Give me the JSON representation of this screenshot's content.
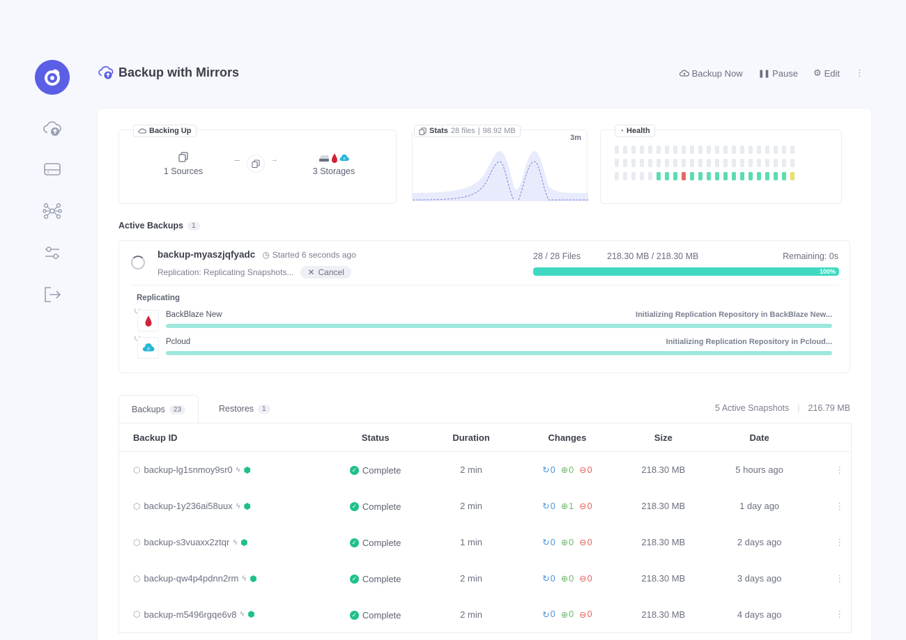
{
  "sidebar": {
    "items": [
      {
        "name": "backups",
        "icon": "cloud-upload-icon"
      },
      {
        "name": "storages",
        "icon": "hard-drive-icon"
      },
      {
        "name": "connections",
        "icon": "network-icon"
      },
      {
        "name": "settings",
        "icon": "sliders-icon"
      },
      {
        "name": "logout",
        "icon": "logout-icon"
      }
    ]
  },
  "header": {
    "title": "Backup with Mirrors",
    "actions": {
      "backup_now": "Backup Now",
      "pause": "Pause",
      "edit": "Edit"
    }
  },
  "summary": {
    "backing_up": {
      "label": "Backing Up",
      "sources": "1 Sources",
      "storages": "3 Storages"
    },
    "stats": {
      "label": "Stats",
      "files": "28 files",
      "size": "98.92 MB",
      "time": "3m"
    },
    "health": {
      "label": "Health"
    }
  },
  "active_backups": {
    "title": "Active Backups",
    "count": "1",
    "item": {
      "id": "backup-myaszjqfyadc",
      "started": "Started 6 seconds ago",
      "status": "Replication: Replicating Snapshots...",
      "cancel": "Cancel",
      "files": "28 / 28 Files",
      "bytes": "218.30 MB / 218.30 MB",
      "remaining": "Remaining: 0s",
      "percent_label": "100%",
      "percent": 100
    },
    "replicating": {
      "title": "Replicating",
      "targets": [
        {
          "name": "BackBlaze New",
          "message": "Initializing Replication Repository in BackBlaze New...",
          "progress": 100
        },
        {
          "name": "Pcloud",
          "message": "Initializing Replication Repository in Pcloud...",
          "progress": 100
        }
      ]
    }
  },
  "tabs": {
    "backups": {
      "label": "Backups",
      "count": "23"
    },
    "restores": {
      "label": "Restores",
      "count": "1"
    },
    "snapshots": "5 Active Snapshots",
    "total_size": "216.79 MB"
  },
  "table": {
    "headers": [
      "Backup ID",
      "Status",
      "Duration",
      "Changes",
      "Size",
      "Date"
    ],
    "rows": [
      {
        "id": "backup-lg1snmoy9sr0",
        "status": "Complete",
        "duration": "2 min",
        "changes": [
          "0",
          "0",
          "0"
        ],
        "size": "218.30 MB",
        "date": "5 hours ago"
      },
      {
        "id": "backup-1y236ai58uux",
        "status": "Complete",
        "duration": "2 min",
        "changes": [
          "0",
          "1",
          "0"
        ],
        "size": "218.30 MB",
        "date": "1 day ago"
      },
      {
        "id": "backup-s3vuaxx2ztqr",
        "status": "Complete",
        "duration": "1 min",
        "changes": [
          "0",
          "0",
          "0"
        ],
        "size": "218.30 MB",
        "date": "2 days ago"
      },
      {
        "id": "backup-qw4p4pdnn2rm",
        "status": "Complete",
        "duration": "2 min",
        "changes": [
          "0",
          "0",
          "0"
        ],
        "size": "218.30 MB",
        "date": "3 days ago"
      },
      {
        "id": "backup-m5496rgqe6v8",
        "status": "Complete",
        "duration": "2 min",
        "changes": [
          "0",
          "0",
          "0"
        ],
        "size": "218.30 MB",
        "date": "4 days ago"
      }
    ]
  },
  "colors": {
    "accent": "#5b5fe6",
    "progress": "#3fd9c1",
    "complete": "#20c08a",
    "health_ok": "#5ddcb0",
    "health_bad": "#e86a5f",
    "health_warn": "#e8e06a"
  }
}
